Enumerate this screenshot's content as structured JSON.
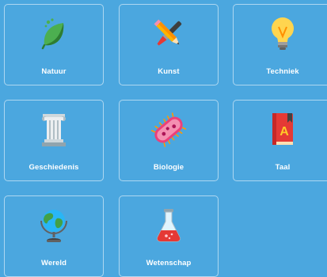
{
  "categories": [
    {
      "label": "Natuur",
      "icon": "leaf-icon"
    },
    {
      "label": "Kunst",
      "icon": "pencil-brush-icon"
    },
    {
      "label": "Techniek",
      "icon": "lightbulb-icon"
    },
    {
      "label": "Geschiedenis",
      "icon": "column-icon"
    },
    {
      "label": "Biologie",
      "icon": "bacterium-icon"
    },
    {
      "label": "Taal",
      "icon": "book-icon"
    },
    {
      "label": "Wereld",
      "icon": "globe-icon"
    },
    {
      "label": "Wetenschap",
      "icon": "flask-icon"
    }
  ],
  "colors": {
    "background": "#4ba7df",
    "tile_border": "#ffffff",
    "label": "#ffffff"
  }
}
